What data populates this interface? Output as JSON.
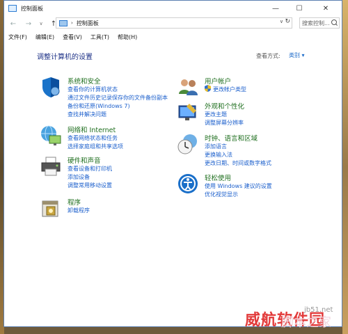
{
  "window": {
    "title": "控制面板",
    "controls": {
      "minimize": "—",
      "maximize": "☐",
      "close": "✕"
    }
  },
  "nav": {
    "back": "←",
    "forward": "→",
    "up": "↑",
    "address": "控制面板",
    "address_sep": "›",
    "dropdown": "∨",
    "refresh": "↻",
    "search_placeholder": "搜索控制..."
  },
  "menu": [
    "文件(F)",
    "编辑(E)",
    "查看(V)",
    "工具(T)",
    "帮助(H)"
  ],
  "main": {
    "heading": "调整计算机的设置",
    "view_by_label": "查看方式:",
    "view_by_value": "类别 ▾"
  },
  "categories": [
    {
      "title": "系统和安全",
      "icon": "shield-icon",
      "links": [
        "查看你的计算机状态",
        "通过文件历史记录保存你的文件备份副本",
        "备份和还原(Windows 7)",
        "查找并解决问题"
      ]
    },
    {
      "title": "网络和 Internet",
      "icon": "network-globe-icon",
      "links": [
        "查看网络状态和任务",
        "选择家庭组和共享选项"
      ]
    },
    {
      "title": "硬件和声音",
      "icon": "printer-icon",
      "links": [
        "查看设备和打印机",
        "添加设备",
        "调整常用移动设置"
      ]
    },
    {
      "title": "程序",
      "icon": "programs-icon",
      "links": [
        "卸载程序"
      ]
    },
    {
      "title": "用户帐户",
      "icon": "users-icon",
      "links": [
        "更改帐户类型"
      ]
    },
    {
      "title": "外观和个性化",
      "icon": "appearance-icon",
      "links": [
        "更改主题",
        "调整屏幕分辨率"
      ]
    },
    {
      "title": "时钟、语言和区域",
      "icon": "clock-globe-icon",
      "links": [
        "添加语言",
        "更换输入法",
        "更改日期、时间或数字格式"
      ]
    },
    {
      "title": "轻松使用",
      "icon": "accessibility-icon",
      "links": [
        "使用 Windows 建议的设置",
        "优化视觉显示"
      ]
    }
  ],
  "watermark": {
    "text1": "威航软件园",
    "text2": "脚本之家",
    "text3": "jb51.net"
  }
}
